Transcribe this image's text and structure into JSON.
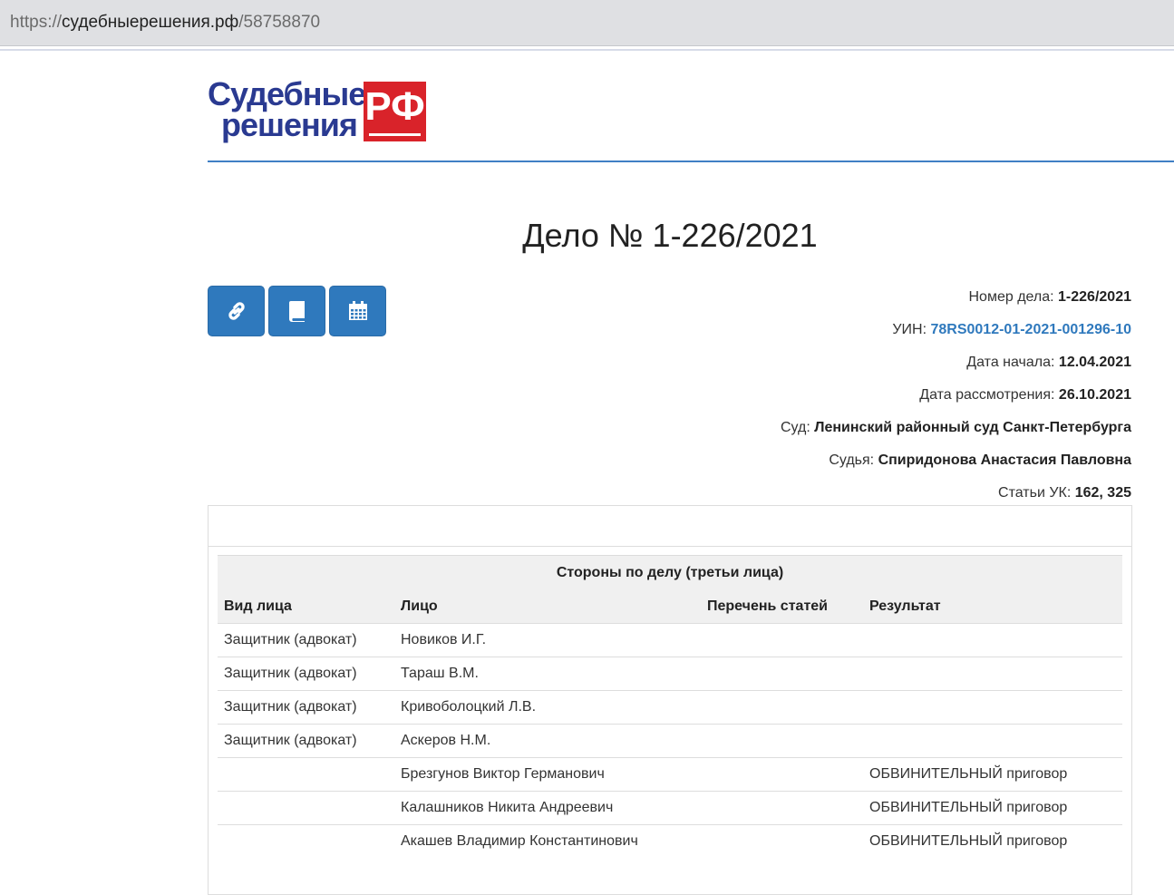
{
  "browser": {
    "url_protocol": "https://",
    "url_host": "судебныерешения.рф",
    "url_path": "/58758870"
  },
  "logo": {
    "line1": "Судебные",
    "line2": "решения",
    "badge": "РФ"
  },
  "case": {
    "title": "Дело № 1-226/2021"
  },
  "actions": {
    "buttons": [
      {
        "name": "link",
        "icon": "link-icon"
      },
      {
        "name": "document",
        "icon": "book-icon"
      },
      {
        "name": "calendar",
        "icon": "calendar-icon"
      }
    ]
  },
  "details": {
    "case_number_label": "Номер дела:",
    "case_number_value": "1-226/2021",
    "uin_label": "УИН:",
    "uin_value": "78RS0012-01-2021-001296-10",
    "start_date_label": "Дата начала:",
    "start_date_value": "12.04.2021",
    "review_date_label": "Дата рассмотрения:",
    "review_date_value": "26.10.2021",
    "court_label": "Суд:",
    "court_value": "Ленинский районный суд Санкт-Петербурга",
    "judge_label": "Судья:",
    "judge_value": "Спиридонова Анастасия Павловна",
    "articles_label": "Статьи УК:",
    "articles_value": "162, 325"
  },
  "parties": {
    "caption": "Стороны по делу (третьи лица)",
    "columns": [
      "Вид лица",
      "Лицо",
      "Перечень статей",
      "Результат"
    ],
    "rows": [
      {
        "role": "Защитник (адвокат)",
        "person": "Новиков И.Г.",
        "articles": "",
        "result": ""
      },
      {
        "role": "Защитник (адвокат)",
        "person": "Тараш В.М.",
        "articles": "",
        "result": ""
      },
      {
        "role": "Защитник (адвокат)",
        "person": "Кривоболоцкий Л.В.",
        "articles": "",
        "result": ""
      },
      {
        "role": "Защитник (адвокат)",
        "person": "Аскеров Н.М.",
        "articles": "",
        "result": ""
      },
      {
        "role": "",
        "person": "Брезгунов Виктор Германович",
        "articles": "",
        "result": "ОБВИНИТЕЛЬНЫЙ приговор"
      },
      {
        "role": "",
        "person": "Калашников Никита Андреевич",
        "articles": "",
        "result": "ОБВИНИТЕЛЬНЫЙ приговор"
      },
      {
        "role": "",
        "person": "Акашев Владимир Константинович",
        "articles": "",
        "result": "ОБВИНИТЕЛЬНЫЙ приговор"
      }
    ]
  },
  "colors": {
    "accent": "#2f79bd",
    "logo_blue": "#2a3a91",
    "logo_red": "#d9232a"
  }
}
